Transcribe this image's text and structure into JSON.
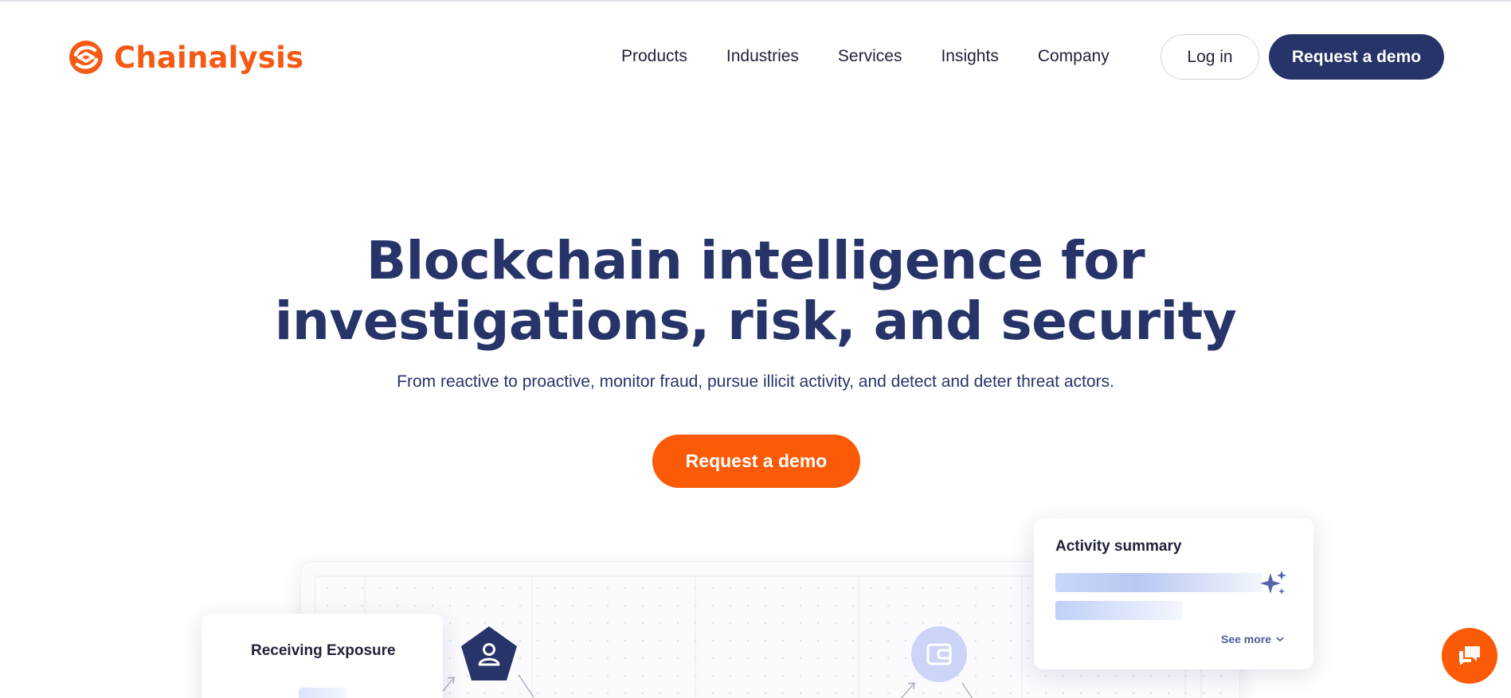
{
  "header": {
    "brand": "Chainalysis",
    "nav": [
      {
        "label": "Products"
      },
      {
        "label": "Industries"
      },
      {
        "label": "Services"
      },
      {
        "label": "Insights"
      },
      {
        "label": "Company"
      }
    ],
    "login_label": "Log in",
    "demo_label": "Request a demo"
  },
  "hero": {
    "title_line1": "Blockchain intelligence for",
    "title_line2": "investigations, risk, and security",
    "subtitle": "From reactive to proactive, monitor fraud, pursue illicit activity, and detect and deter threat actors.",
    "cta_label": "Request a demo"
  },
  "illustration": {
    "exposure_card_title": "Receiving Exposure",
    "activity_card_title": "Activity summary",
    "see_more_label": "See more"
  },
  "icons": {
    "logo": "chainalysis-logo-icon",
    "user_node": "user-icon",
    "wallet_node": "wallet-icon",
    "sparkle": "sparkle-icon",
    "chevron": "chevron-down-icon",
    "chat": "chat-icon"
  },
  "colors": {
    "brand_orange": "#fb5a06",
    "navy": "#273469",
    "light_periwinkle": "#ccd4f7"
  }
}
